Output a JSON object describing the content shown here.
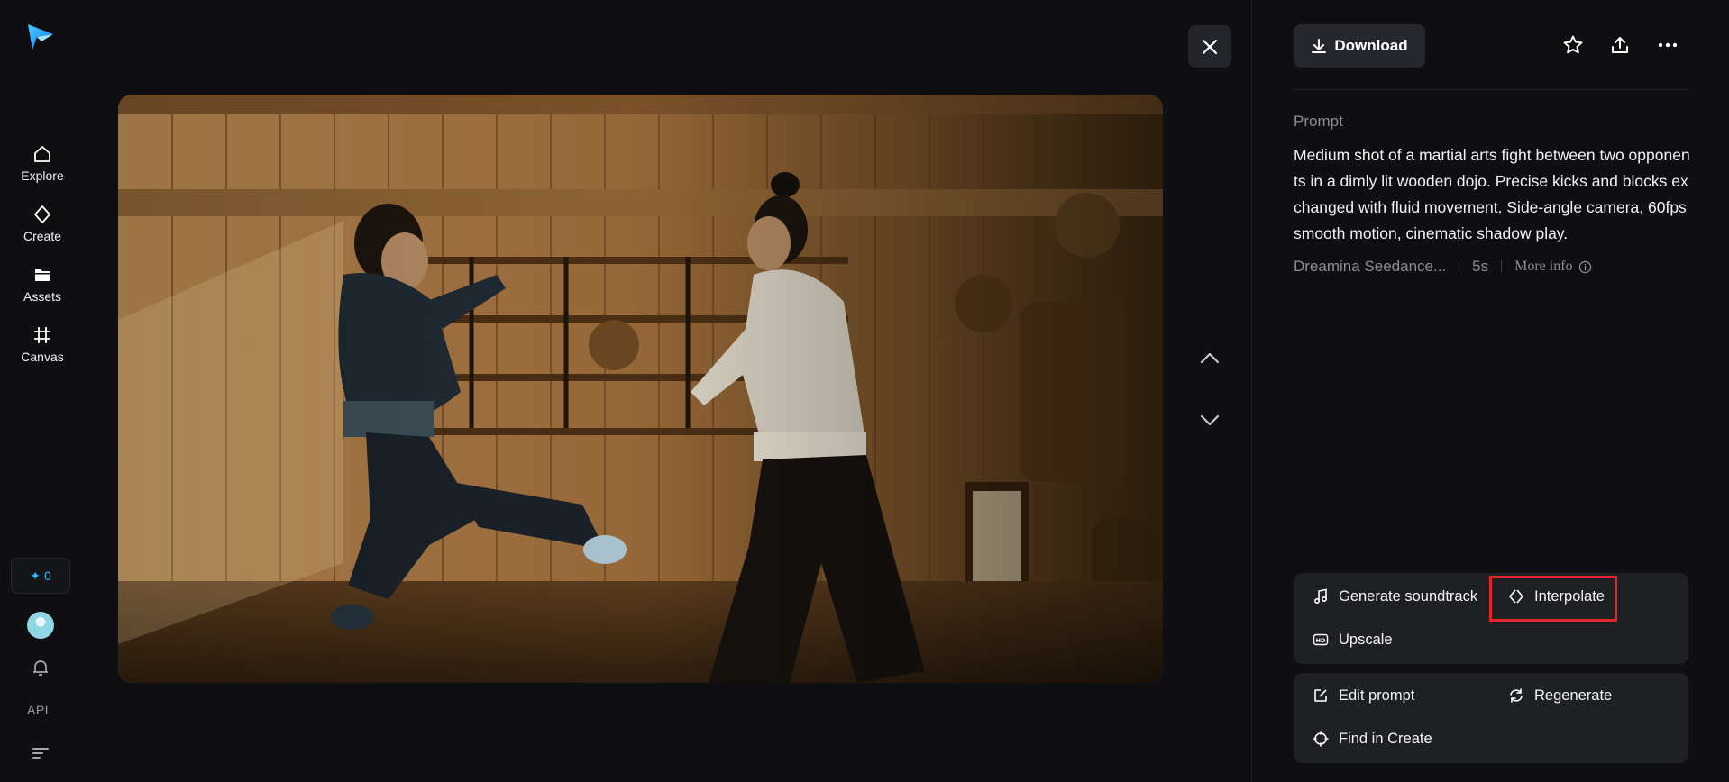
{
  "sidebar": {
    "nav": [
      {
        "label": "Explore",
        "icon": "home-icon"
      },
      {
        "label": "Create",
        "icon": "diamond-sparkle-icon"
      },
      {
        "label": "Assets",
        "icon": "folder-icon"
      },
      {
        "label": "Canvas",
        "icon": "canvas-grid-icon"
      }
    ],
    "credits": "0",
    "api_label": "API"
  },
  "viewer": {
    "image_description_icon": "video-frame",
    "close_icon": "close-icon"
  },
  "panel": {
    "download_label": "Download",
    "prompt_label": "Prompt",
    "prompt_text": "Medium shot of a martial arts fight between two opponents in a dimly lit wooden dojo. Precise kicks and blocks exchanged with fluid movement. Side-angle camera, 60fps smooth motion, cinematic shadow play.",
    "model": "Dreamina Seedance...",
    "duration": "5s",
    "more_info": "More info",
    "actions_group1": [
      {
        "label": "Generate soundtrack",
        "icon": "music-note-icon"
      },
      {
        "label": "Interpolate",
        "icon": "interpolate-icon"
      },
      {
        "label": "Upscale",
        "icon": "hd-icon"
      }
    ],
    "actions_group2": [
      {
        "label": "Edit prompt",
        "icon": "edit-icon"
      },
      {
        "label": "Regenerate",
        "icon": "refresh-icon"
      },
      {
        "label": "Find in Create",
        "icon": "target-icon"
      }
    ]
  },
  "colors": {
    "background": "#0f0f11",
    "card": "#1f2024",
    "accent": "#30b7ff",
    "highlight": "#e3262a"
  }
}
